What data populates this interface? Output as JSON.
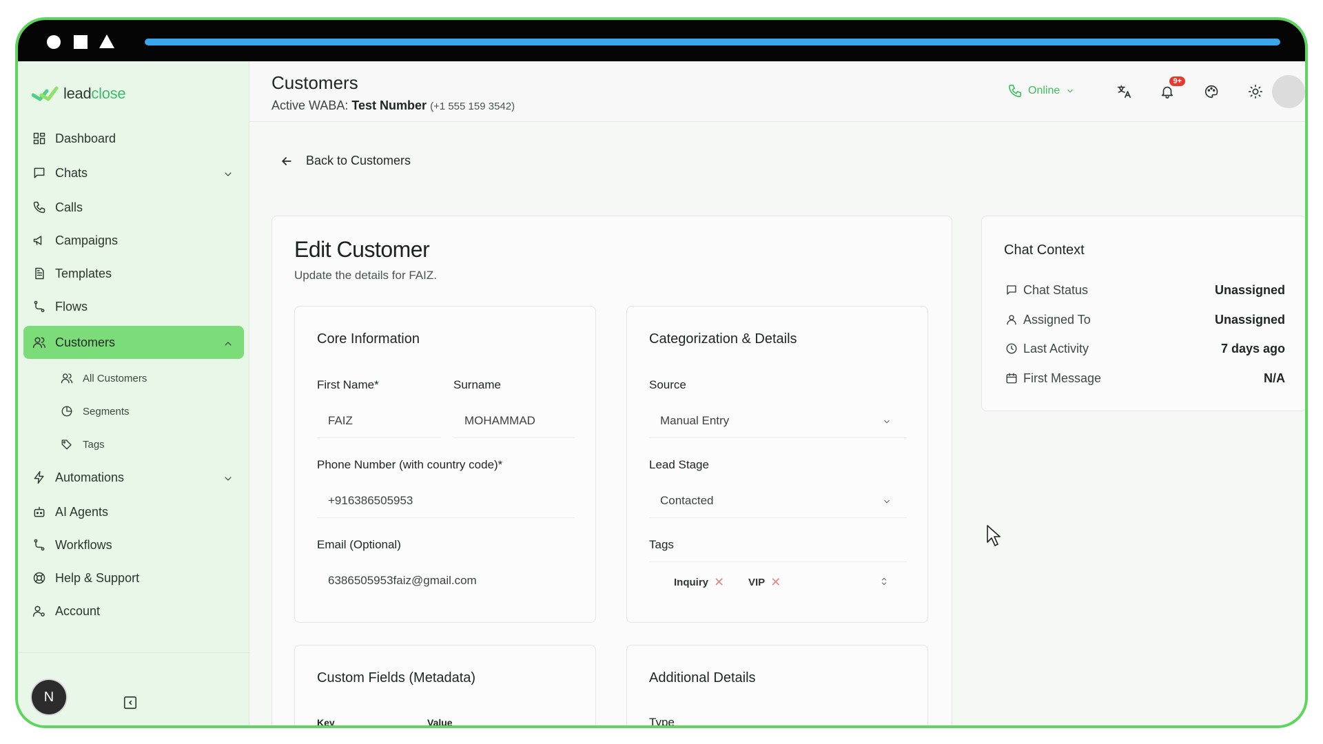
{
  "recording": {
    "progress_fraction": 1.0
  },
  "app": {
    "logo_prefix": "lead",
    "logo_suffix": "close"
  },
  "sidebar": {
    "items": [
      {
        "label": "Dashboard",
        "icon": "dashboard-icon"
      },
      {
        "label": "Chats",
        "icon": "chat-icon"
      },
      {
        "label": "Calls",
        "icon": "phone-icon"
      },
      {
        "label": "Campaigns",
        "icon": "megaphone-icon"
      },
      {
        "label": "Templates",
        "icon": "document-icon"
      },
      {
        "label": "Flows",
        "icon": "flow-icon"
      },
      {
        "label": "Customers",
        "icon": "users-icon"
      },
      {
        "label": "Automations",
        "icon": "bolt-icon"
      },
      {
        "label": "AI Agents",
        "icon": "robot-icon"
      },
      {
        "label": "Workflows",
        "icon": "flow-icon"
      },
      {
        "label": "Help & Support",
        "icon": "lifebuoy-icon"
      },
      {
        "label": "Account",
        "icon": "user-cog-icon"
      }
    ],
    "customers_sub": [
      {
        "label": "All Customers",
        "icon": "users-icon"
      },
      {
        "label": "Segments",
        "icon": "pie-icon"
      },
      {
        "label": "Tags",
        "icon": "tags-icon"
      }
    ],
    "user_initial": "N"
  },
  "header": {
    "title": "Customers",
    "waba_prefix": "Active WABA:",
    "waba_name": "Test Number",
    "waba_number": "(+1 555 159 3542)",
    "status": "Online",
    "notif_badge": "9+"
  },
  "back_label": "Back to Customers",
  "edit": {
    "title": "Edit Customer",
    "subtitle": "Update the details for FAIZ.",
    "core": {
      "title": "Core Information",
      "first_name_label": "First Name*",
      "first_name": "FAIZ",
      "surname_label": "Surname",
      "surname": "MOHAMMAD",
      "phone_label": "Phone Number (with country code)*",
      "phone": "+916386505953",
      "email_label": "Email (Optional)",
      "email": "6386505953faiz@gmail.com"
    },
    "categorization": {
      "title": "Categorization & Details",
      "source_label": "Source",
      "source": "Manual Entry",
      "lead_stage_label": "Lead Stage",
      "lead_stage": "Contacted",
      "tags_label": "Tags",
      "tags": [
        "Inquiry",
        "VIP"
      ]
    },
    "custom": {
      "title": "Custom Fields (Metadata)",
      "key_label": "Key",
      "value_label": "Value"
    },
    "additional": {
      "title": "Additional Details",
      "type_label": "Type"
    }
  },
  "context": {
    "title": "Chat Context",
    "rows": [
      {
        "label": "Chat Status",
        "value": "Unassigned",
        "icon": "chat-icon"
      },
      {
        "label": "Assigned To",
        "value": "Unassigned",
        "icon": "user-icon"
      },
      {
        "label": "Last Activity",
        "value": "7 days ago",
        "icon": "clock-icon"
      },
      {
        "label": "First Message",
        "value": "N/A",
        "icon": "calendar-icon"
      }
    ]
  }
}
